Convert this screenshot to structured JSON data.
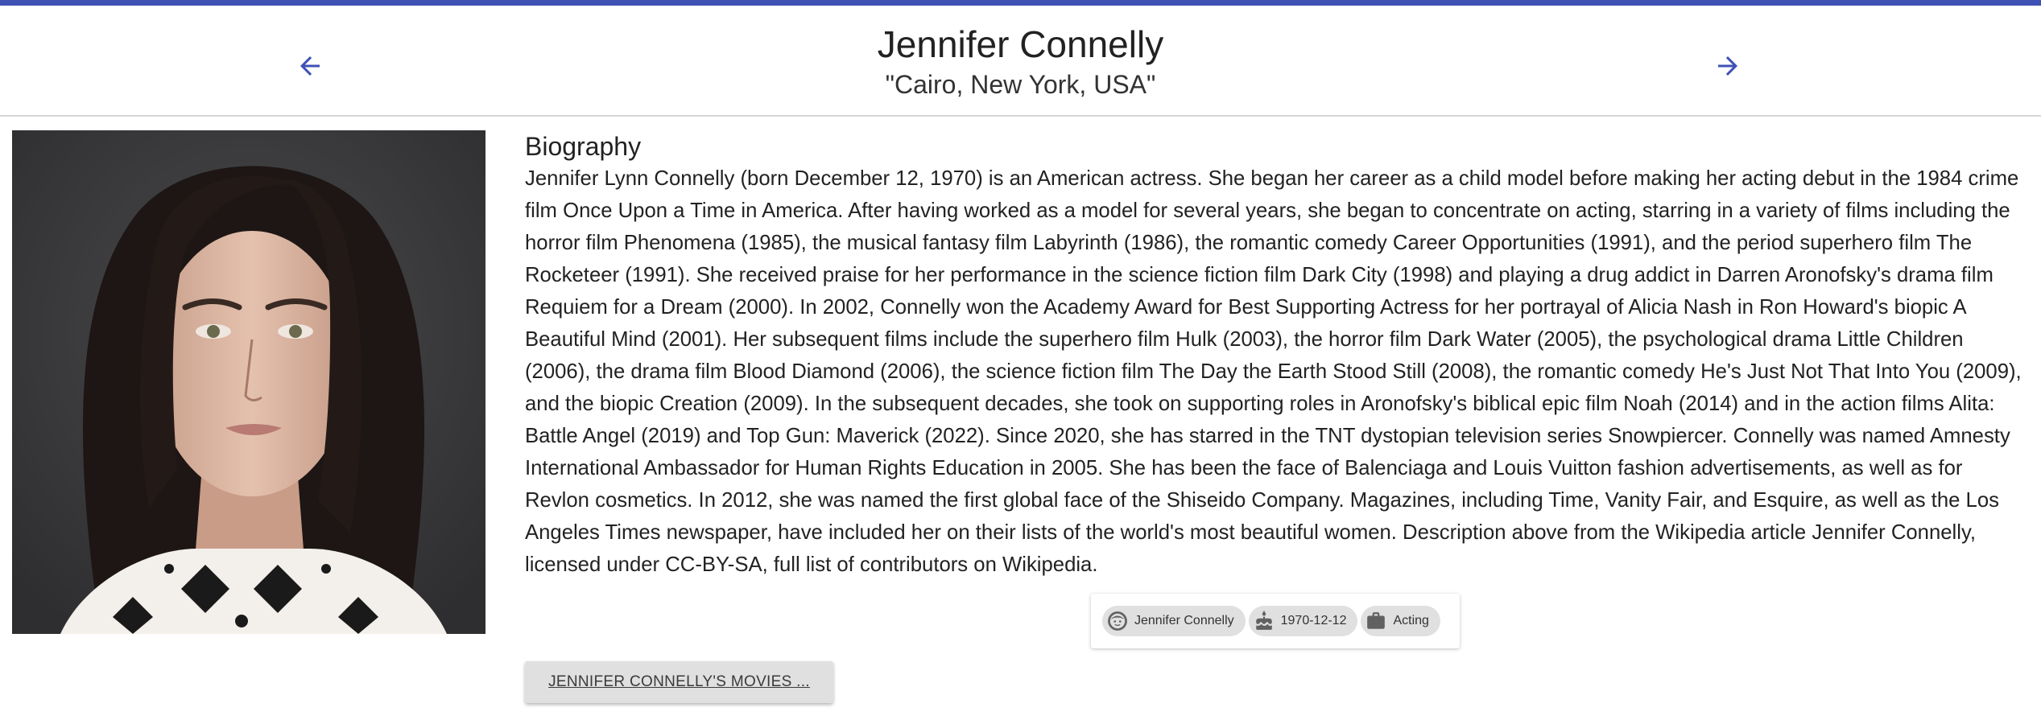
{
  "header": {
    "title": "Jennifer Connelly",
    "subtitle": "\"Cairo, New York, USA\"",
    "prev_icon": "arrow-left-icon",
    "next_icon": "arrow-right-icon"
  },
  "colors": {
    "accent": "#3f51b5",
    "chip_bg": "#e0e0e0",
    "button_bg": "#e0e0e0"
  },
  "biography": {
    "heading": "Biography",
    "text": "Jennifer Lynn Connelly (born December 12, 1970) is an American actress. She began her career as a child model before making her acting debut in the 1984 crime film Once Upon a Time in America. After having worked as a model for several years, she began to concentrate on acting, starring in a variety of films including the horror film Phenomena (1985), the musical fantasy film Labyrinth (1986), the romantic comedy Career Opportunities (1991), and the period superhero film The Rocketeer (1991). She received praise for her performance in the science fiction film Dark City (1998) and playing a drug addict in Darren Aronofsky's drama film Requiem for a Dream (2000). In 2002, Connelly won the Academy Award for Best Supporting Actress for her portrayal of Alicia Nash in Ron Howard's biopic A Beautiful Mind (2001). Her subsequent films include the superhero film Hulk (2003), the horror film Dark Water (2005), the psychological drama Little Children (2006), the drama film Blood Diamond (2006), the science fiction film The Day the Earth Stood Still (2008), the romantic comedy He's Just Not That Into You (2009), and the biopic Creation (2009). In the subsequent decades, she took on supporting roles in Aronofsky's biblical epic film Noah (2014) and in the action films Alita: Battle Angel (2019) and Top Gun: Maverick (2022). Since 2020, she has starred in the TNT dystopian television series Snowpiercer. Connelly was named Amnesty International Ambassador for Human Rights Education in 2005. She has been the face of Balenciaga and Louis Vuitton fashion advertisements, as well as for Revlon cosmetics. In 2012, she was named the first global face of the Shiseido Company. Magazines, including Time, Vanity Fair, and Esquire, as well as the Los Angeles Times newspaper, have included her on their lists of the world's most beautiful women. Description above from the Wikipedia article Jennifer Connelly, licensed under CC-BY-SA, full list of contributors on Wikipedia."
  },
  "chips": [
    {
      "icon": "face-icon",
      "label": "Jennifer Connelly"
    },
    {
      "icon": "cake-icon",
      "label": "1970-12-12"
    },
    {
      "icon": "briefcase-icon",
      "label": "Acting"
    }
  ],
  "movies_button": {
    "label": "JENNIFER CONNELLY'S MOVIES ..."
  }
}
